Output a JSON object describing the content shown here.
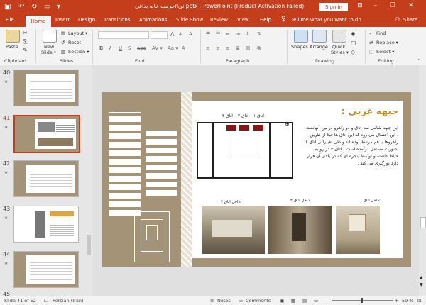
{
  "titlebar": {
    "title": "حرمت خانه بداغیnنی.pptx  -  PowerPoint (Product Activation Failed)",
    "sign_in": "Sign in",
    "minimize": "–",
    "restore": "❐",
    "close": "✕"
  },
  "tabs": {
    "file": "File",
    "home": "Home",
    "insert": "Insert",
    "design": "Design",
    "transitions": "Transitions",
    "animations": "Animations",
    "slideshow": "Slide Show",
    "review": "Review",
    "view": "View",
    "help": "Help",
    "tell": "Tell me what you want to do",
    "share": "Share"
  },
  "ribbon": {
    "clipboard": {
      "label": "Clipboard",
      "paste": "Paste"
    },
    "slides": {
      "label": "Slides",
      "new_slide": "New",
      "new_slide2": "Slide ▾",
      "layout": "Layout ▾",
      "reset": "Reset",
      "section": "Section ▾"
    },
    "font": {
      "label": "Font",
      "bold": "B",
      "italic": "I",
      "underline": "U",
      "strike": "S",
      "shadow": "abc",
      "spacing": "AV ▾",
      "case": "Aa ▾",
      "grow": "A",
      "shrink": "A",
      "clear": "A"
    },
    "paragraph": {
      "label": "Paragraph"
    },
    "drawing": {
      "label": "Drawing",
      "shapes": "Shapes",
      "arrange": "Arrange",
      "quick": "Quick",
      "styles": "Styles ▾"
    },
    "editing": {
      "label": "Editing",
      "find": "Find",
      "replace": "Replace ▾",
      "select": "Select ▾"
    }
  },
  "thumbnails": [
    {
      "num": "40",
      "star": "★"
    },
    {
      "num": "41",
      "star": "★"
    },
    {
      "num": "42",
      "star": "★"
    },
    {
      "num": "43",
      "star": "★"
    },
    {
      "num": "44",
      "star": "★"
    },
    {
      "num": "45",
      "star": ""
    }
  ],
  "slide": {
    "heading": "جبهه غربی :",
    "body": "این جبهه شامل سه اتاق و دو راهرو در بین آنهاست ، این احتمال می رود که این اتاق ها قبلا از طریق راهروها با هم مرتبط بوده اند و طی تغییراتی اتاق ۱ بصورت مستقل درآمده است .  اتاق ۳ در رو به حیاط داشته و توسط پنجره ای که در بالای آن قرار دارد نورگیری می کند .",
    "room_labels": [
      "اتاق ۱",
      "اتاق ۲",
      "اتاق ۳"
    ],
    "captions": [
      "داخل اتاق ۳:",
      "داخل اتاق ۲:",
      "داخل اتاق ۱:"
    ]
  },
  "status": {
    "slide_of": "Slide 41 of 52",
    "language": "Persian (Iran)",
    "notes": "Notes",
    "comments": "Comments",
    "zoom": "59 %"
  },
  "colors": {
    "accent": "#c43e1c",
    "slide_bg": "#a49377",
    "room_red": "#8b1414"
  }
}
